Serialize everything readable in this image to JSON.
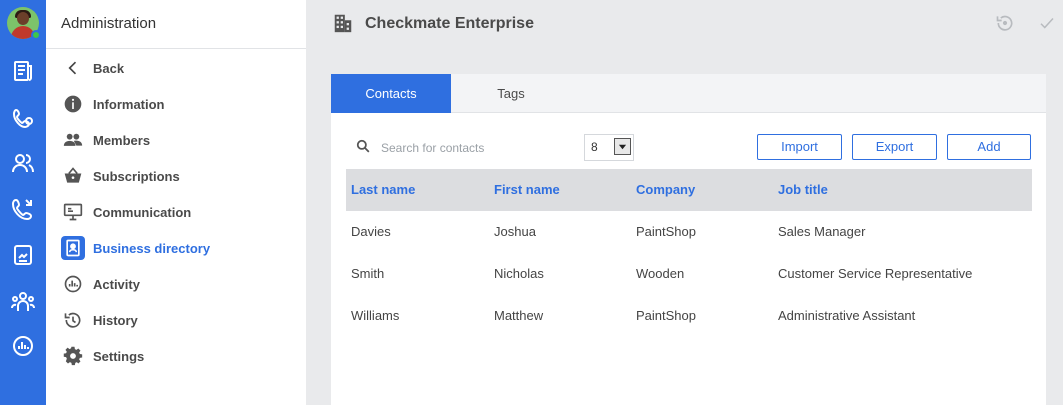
{
  "sidebar": {
    "title": "Administration",
    "items": [
      {
        "label": "Back",
        "icon": "chevron-left-icon"
      },
      {
        "label": "Information",
        "icon": "info-icon"
      },
      {
        "label": "Members",
        "icon": "members-icon"
      },
      {
        "label": "Subscriptions",
        "icon": "basket-icon"
      },
      {
        "label": "Communication",
        "icon": "communication-icon"
      },
      {
        "label": "Business directory",
        "icon": "contact-card-icon",
        "active": true
      },
      {
        "label": "Activity",
        "icon": "activity-icon"
      },
      {
        "label": "History",
        "icon": "history-icon"
      },
      {
        "label": "Settings",
        "icon": "gear-icon"
      }
    ]
  },
  "rail": {
    "icons": [
      "news-icon",
      "conference-icon",
      "contacts-icon",
      "phone-icon",
      "document-icon",
      "groups-icon",
      "analytics-icon"
    ]
  },
  "header": {
    "title": "Checkmate Enterprise",
    "icon": "building-icon"
  },
  "tabs": [
    {
      "label": "Contacts",
      "active": true
    },
    {
      "label": "Tags",
      "active": false
    }
  ],
  "search": {
    "placeholder": "Search for contacts"
  },
  "page_size": {
    "value": "8"
  },
  "actions": {
    "import": "Import",
    "export": "Export",
    "add": "Add"
  },
  "table": {
    "columns": [
      "Last name",
      "First name",
      "Company",
      "Job title"
    ],
    "rows": [
      [
        "Davies",
        "Joshua",
        "PaintShop",
        "Sales Manager"
      ],
      [
        "Smith",
        "Nicholas",
        "Wooden",
        "Customer Service Representative"
      ],
      [
        "Williams",
        "Matthew",
        "PaintShop",
        "Administrative Assistant"
      ]
    ]
  },
  "colors": {
    "accent": "#2f6fe0",
    "rail": "#2f6fe0",
    "presence": "#3ec64a"
  }
}
